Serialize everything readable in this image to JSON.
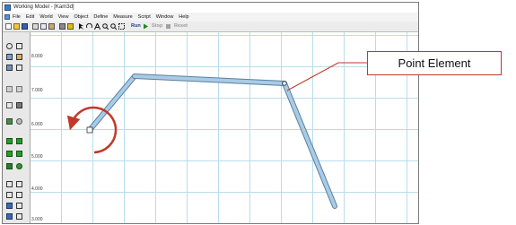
{
  "window": {
    "title": "Working Model - [Kam3d]"
  },
  "menubar": {
    "items": [
      "File",
      "Edit",
      "World",
      "View",
      "Object",
      "Define",
      "Measure",
      "Script",
      "Window",
      "Help"
    ]
  },
  "toolbar": {
    "run_label": "Run",
    "stop_label": "Stop",
    "reset_label": "Reset"
  },
  "canvas": {
    "ruler_labels": [
      "8.000",
      "7.000",
      "6.000",
      "5.000",
      "4.000",
      "3.000"
    ]
  },
  "annotation": {
    "callout_text": "Point Element",
    "accent_color": "#c0392b",
    "link_color": "#a9cbe6"
  }
}
